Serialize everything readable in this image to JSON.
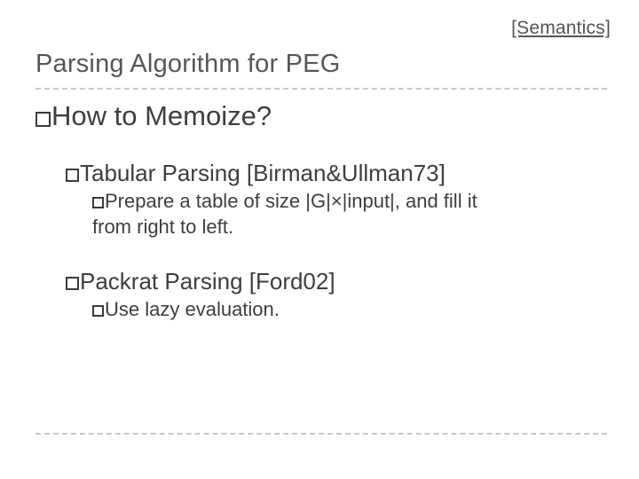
{
  "topic_link": "[Semantics]",
  "title": "Parsing Algorithm for PEG",
  "l1_text": "How to Memoize?",
  "l2a_text": "Tabular Parsing [Birman&Ullman73]",
  "l3a_text": "Prepare a table of size |G|×|input|, and fill it",
  "l3a_cont": "from right to left.",
  "l2b_text": "Packrat Parsing [Ford02]",
  "l3b_text": "Use lazy evaluation."
}
